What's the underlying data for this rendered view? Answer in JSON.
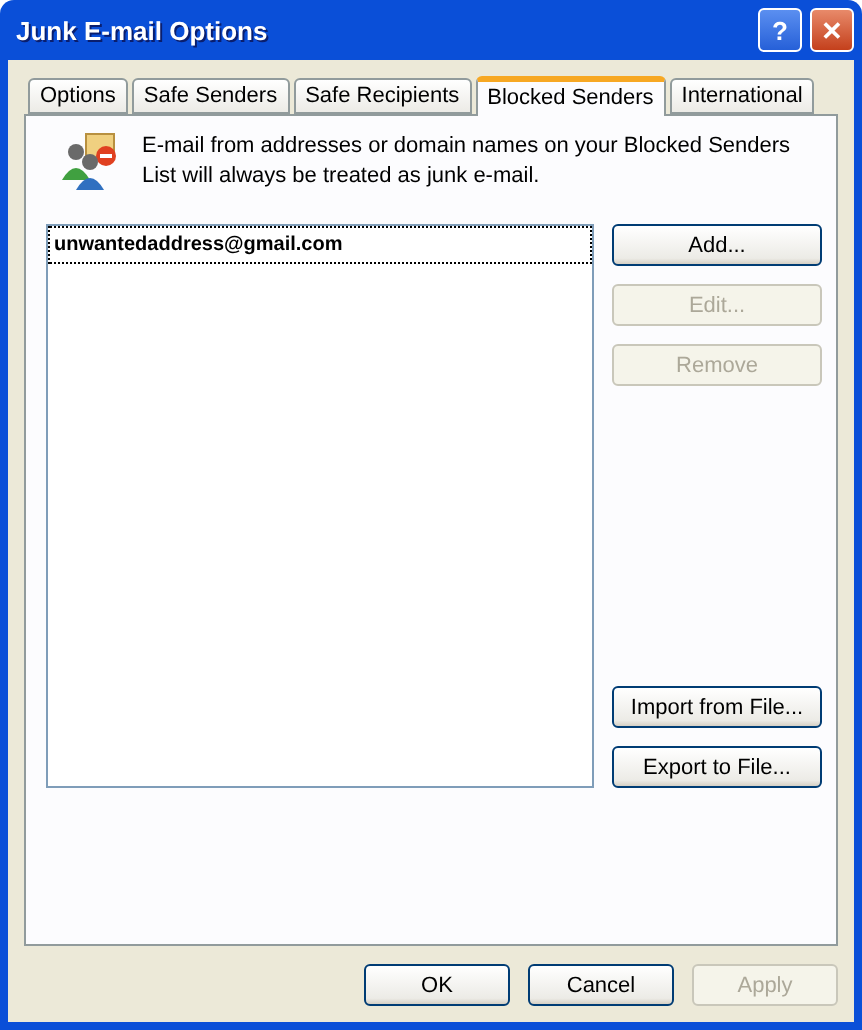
{
  "window": {
    "title": "Junk E-mail Options",
    "help_button": "?",
    "close_button": "✕"
  },
  "tabs": [
    {
      "label": "Options",
      "selected": false
    },
    {
      "label": "Safe Senders",
      "selected": false
    },
    {
      "label": "Safe Recipients",
      "selected": false
    },
    {
      "label": "Blocked Senders",
      "selected": true
    },
    {
      "label": "International",
      "selected": false
    }
  ],
  "description": "E-mail from addresses or domain names on your Blocked Senders List will always be treated as junk e-mail.",
  "list": {
    "items": [
      {
        "label": "unwantedaddress@gmail.com",
        "selected": true
      }
    ]
  },
  "side_buttons_top": [
    {
      "label": "Add...",
      "disabled": false
    },
    {
      "label": "Edit...",
      "disabled": true
    },
    {
      "label": "Remove",
      "disabled": true
    }
  ],
  "side_buttons_bottom": [
    {
      "label": "Import from File...",
      "disabled": false
    },
    {
      "label": "Export to File...",
      "disabled": false
    }
  ],
  "buttons": [
    {
      "label": "OK",
      "disabled": false
    },
    {
      "label": "Cancel",
      "disabled": false
    },
    {
      "label": "Apply",
      "disabled": true
    }
  ]
}
